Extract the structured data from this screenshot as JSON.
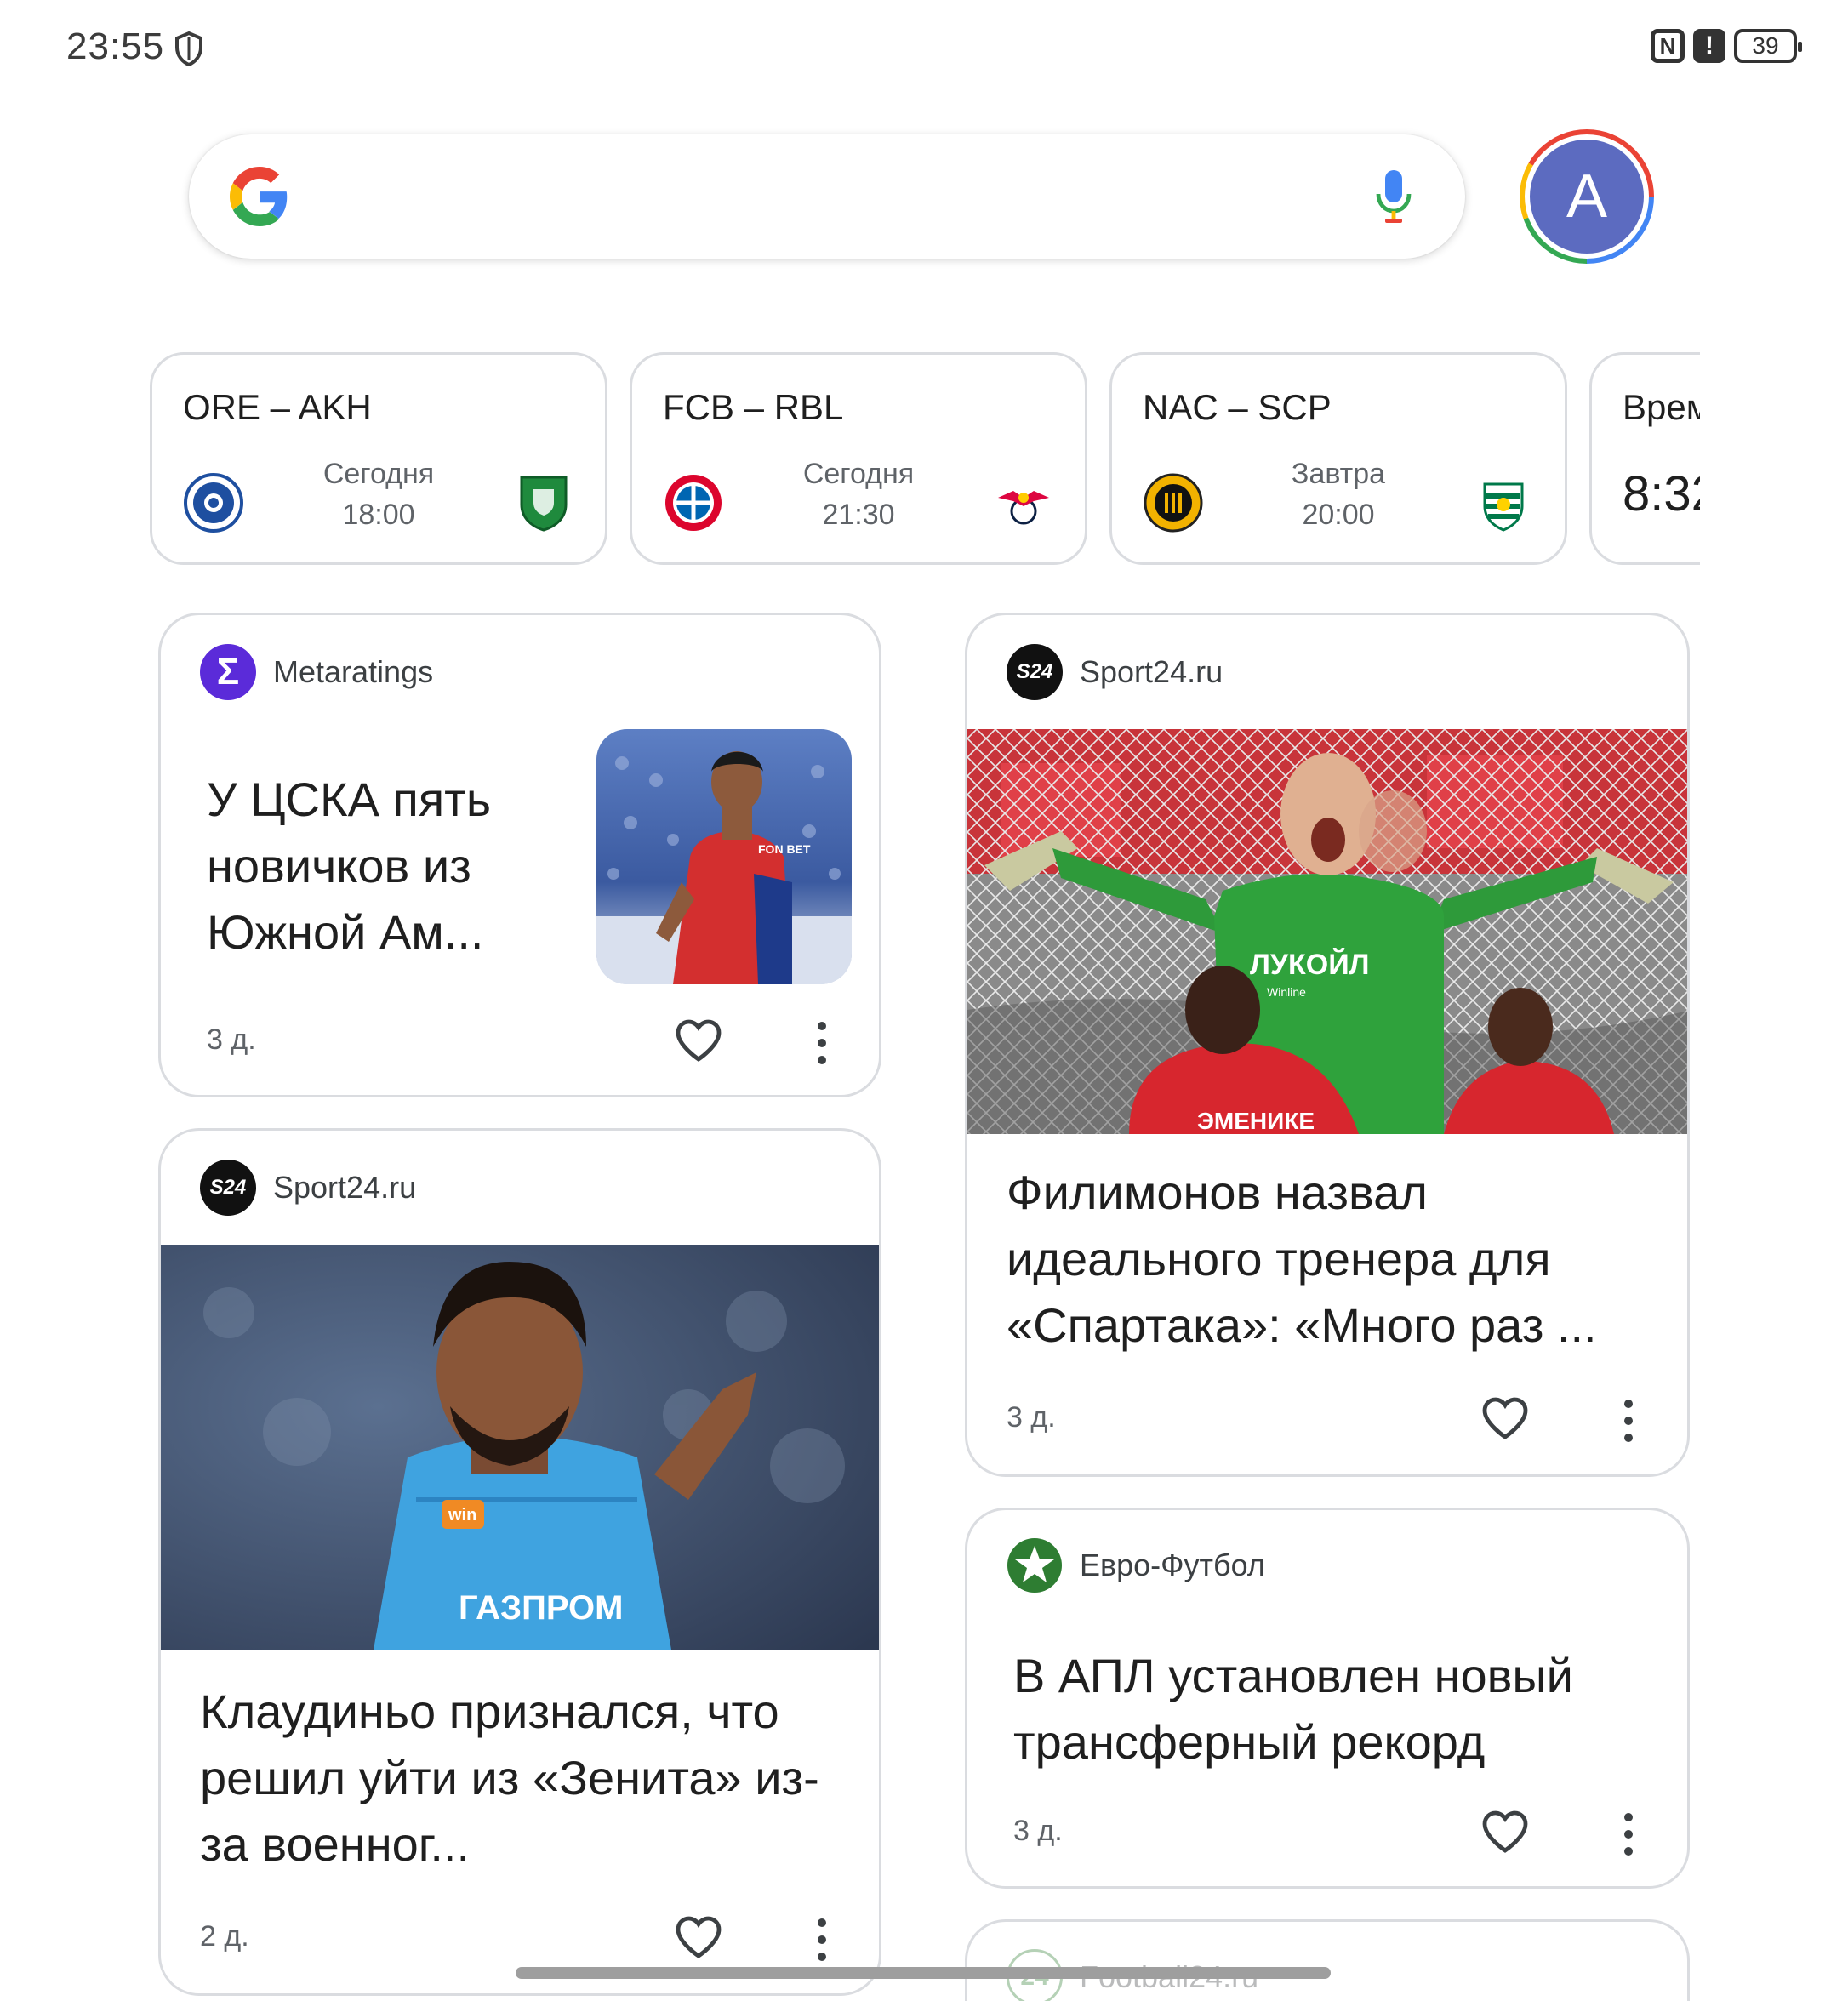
{
  "status": {
    "time": "23:55",
    "battery": "39",
    "nfc_label": "N",
    "alert_label": "!"
  },
  "search": {
    "placeholder": ""
  },
  "account": {
    "initial": "A"
  },
  "matches": [
    {
      "title": "ORE – AKH",
      "day": "Сегодня",
      "time": "18:00"
    },
    {
      "title": "FCB – RBL",
      "day": "Сегодня",
      "time": "21:30"
    },
    {
      "title": "NAC – SCP",
      "day": "Завтра",
      "time": "20:00"
    },
    {
      "title": "Врем",
      "time": "8:32"
    }
  ],
  "feed": [
    {
      "source": "Metaratings",
      "source_icon_text": "Σ",
      "title": "У ЦСКА пять новичков из Южной Ам...",
      "age": "3 д."
    },
    {
      "source": "Sport24.ru",
      "source_icon_text": "S24",
      "title": "Филимонов назвал идеального тренера для «Спартака»: «Много раз ...",
      "age": "3 д."
    },
    {
      "source": "Sport24.ru",
      "source_icon_text": "S24",
      "title": "Клаудиньо признался, что решил уйти из «Зенита» из-за военног...",
      "age": "2 д."
    },
    {
      "source": "Евро-Футбол",
      "title": "В АПЛ установлен новый трансферный рекорд",
      "age": "3 д."
    },
    {
      "source": "Football24.ru",
      "source_icon_text": "24"
    }
  ],
  "photo_text": {
    "goalkeeper_sponsor": "ЛУКОЙЛ",
    "goalkeeper_sub": "Winline",
    "player_jersey_name": "ЭМЕНИКЕ",
    "zenit_sponsor": "ГАЗПРОМ",
    "zenit_badge": "win",
    "cska_sponsor": "FON BET"
  },
  "colors": {
    "metaratings": "#5b2bd9",
    "sport24": "#111111",
    "eurofootball": "#2e7d32",
    "avatar": "#5c6bc0"
  }
}
